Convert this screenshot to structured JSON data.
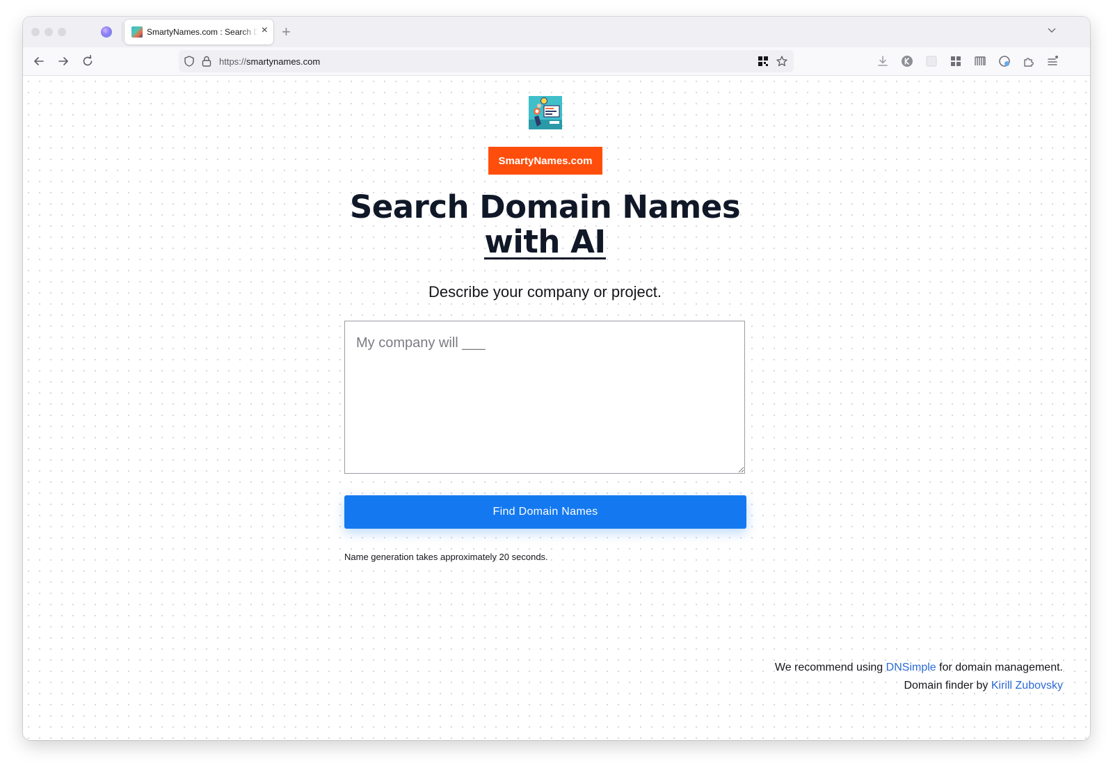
{
  "browser": {
    "tab_title": "SmartyNames.com : Search Domain Names with AI",
    "url": "https://smartynames.com",
    "url_scheme": "https://",
    "url_host": "smartynames.com"
  },
  "page": {
    "brand_label": "SmartyNames.com",
    "heading_line1": "Search Domain Names",
    "heading_line2": "with AI",
    "subtitle": "Describe your company or project.",
    "description_placeholder": "My company will ___",
    "submit_label": "Find Domain Names",
    "timing_note": "Name generation takes approximately 20 seconds.",
    "footer": {
      "line1_prefix": "We recommend using ",
      "line1_link": "DNSimple",
      "line1_suffix": " for domain management.",
      "line2_prefix": "Domain finder by ",
      "line2_link": "Kirill Zubovsky"
    }
  },
  "colors": {
    "brand_orange": "#ff4e0c",
    "button_blue": "#1479f0",
    "link_blue": "#2b6ad6",
    "heading": "#101828"
  }
}
